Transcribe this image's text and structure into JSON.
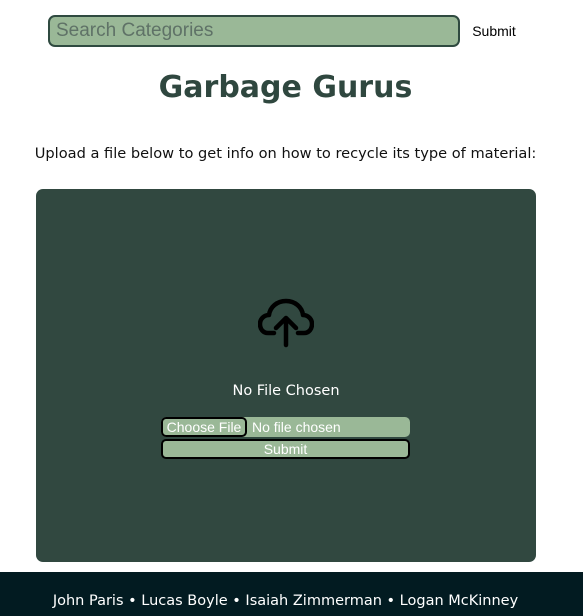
{
  "search": {
    "placeholder": "Search Categories",
    "value": "",
    "submit_label": "Submit"
  },
  "header": {
    "title": "Garbage Gurus"
  },
  "main": {
    "instructions": "Upload a file below to get info on how to recycle its type of material:"
  },
  "upload": {
    "icon": "cloud-upload-icon",
    "status_text": "No File Chosen",
    "choose_file_label": "Choose File",
    "file_name_text": "No file chosen",
    "submit_label": "Submit"
  },
  "footer": {
    "credits": "John Paris • Lucas Boyle • Isaiah Zimmerman • Logan McKinney"
  },
  "colors": {
    "accent": "#9ab897",
    "panel": "#314840",
    "title": "#2f473f",
    "footer": "#021b21"
  }
}
